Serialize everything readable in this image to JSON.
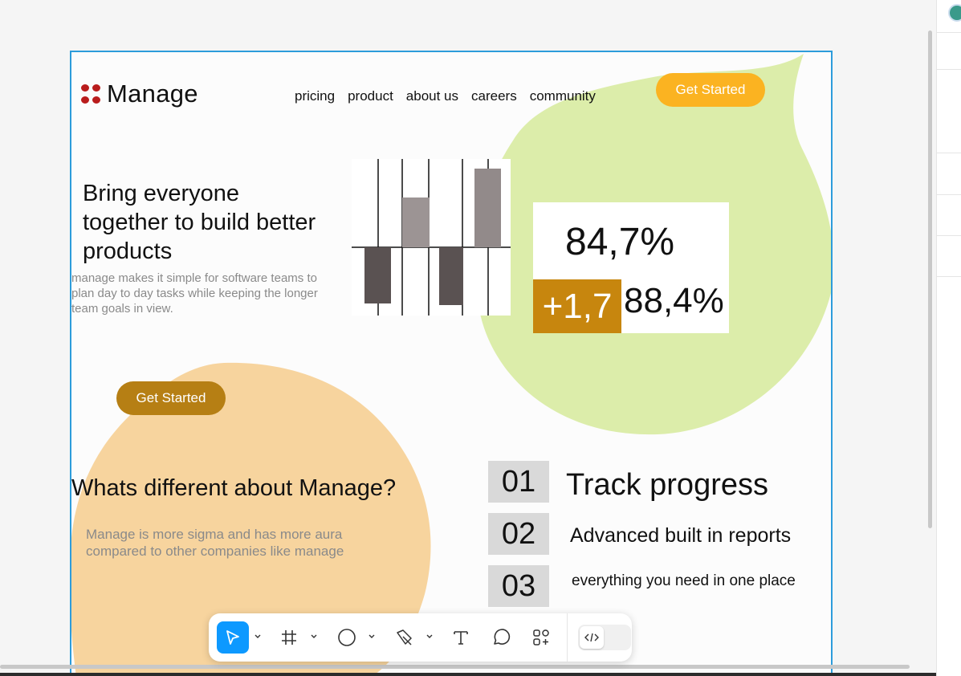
{
  "brand": {
    "name": "Manage",
    "logo_color": "#b91c1c"
  },
  "nav": {
    "items": [
      "pricing",
      "product",
      "about us",
      "careers",
      "community"
    ],
    "cta": "Get Started"
  },
  "hero": {
    "title": "Bring everyone together to build better products",
    "subtitle": "manage makes it simple for software teams to plan day to day tasks while keeping the longer team goals in view.",
    "cta": "Get Started"
  },
  "stats": {
    "main": "84,7%",
    "delta": "+1,7",
    "second": "88,4%"
  },
  "section": {
    "title": "Whats different about Manage?",
    "text": "Manage is more sigma and has more aura compared to other companies like manage"
  },
  "features": [
    {
      "num": "01",
      "text": "Track progress"
    },
    {
      "num": "02",
      "text": "Advanced built in reports"
    },
    {
      "num": "03",
      "text": "everything you need in one place"
    }
  ],
  "colors": {
    "green_blob": "#dcedaa",
    "orange_blob": "#f7d49e",
    "accent": "#fbb321",
    "accent_dark": "#b67f14",
    "selection": "#2d9cdb"
  },
  "toolbar": {
    "tools": [
      "move-icon",
      "frame-icon",
      "ellipse-icon",
      "pen-icon",
      "text-icon",
      "comment-icon",
      "actions-icon",
      "dev-mode-icon"
    ]
  }
}
